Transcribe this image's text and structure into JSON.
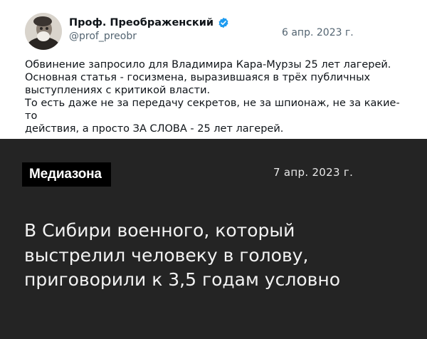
{
  "tweet": {
    "author_name": "Проф. Преображенский",
    "handle": "@prof_preobr",
    "date": "6 апр. 2023 г.",
    "text_lines": [
      "Обвинение запросило для Владимира Кара-Мурзы 25 лет лагерей.",
      "Основная статья - госизмена, выразившаяся в трёх публичных",
      "выступлениях с критикой власти.",
      "То есть даже не за передачу секретов, не за шпионаж, не за какие-то",
      "действия, а просто ЗА СЛОВА - 25 лет лагерей."
    ],
    "verified_icon": "verified-badge-icon",
    "accent_color": "#1d9bf0"
  },
  "card": {
    "logo_text": "Медиазона",
    "date": "7 апр. 2023 г.",
    "headline_lines": [
      "В Сибири военного, который",
      "выстрелил человеку в голову,",
      "приговорили к 3,5 годам условно"
    ],
    "background_color": "#242424"
  }
}
